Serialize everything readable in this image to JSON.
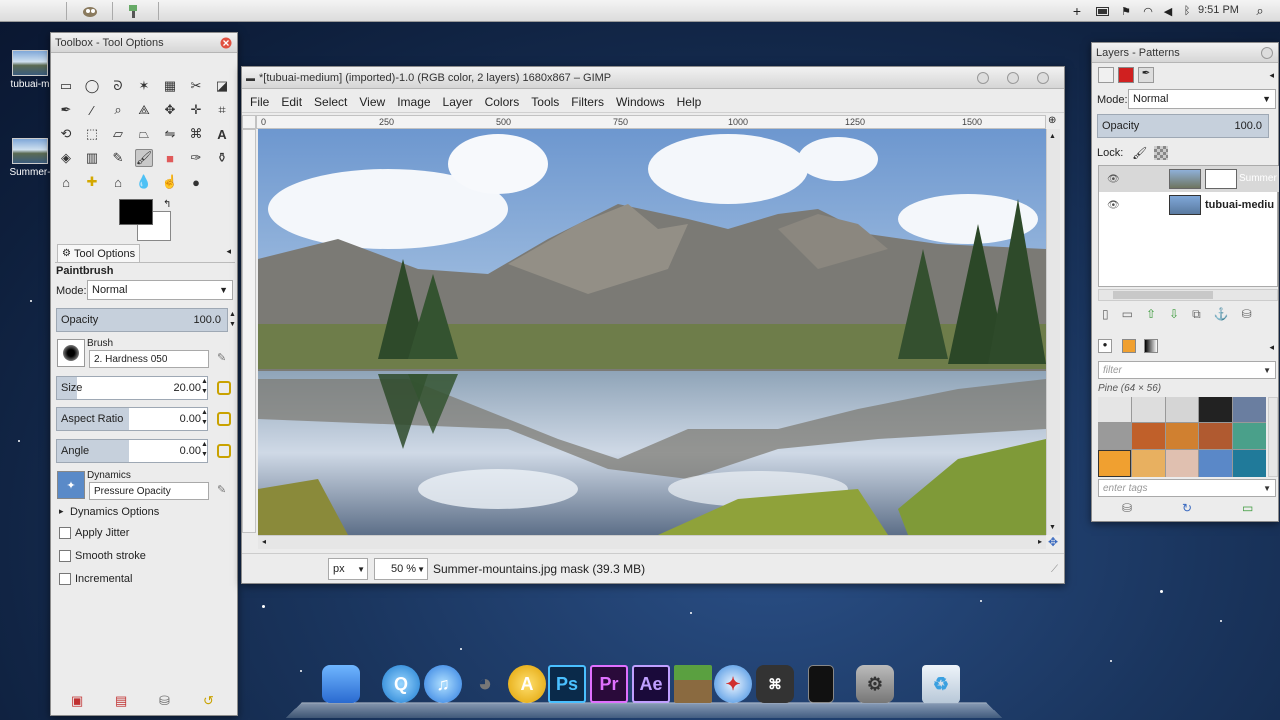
{
  "menubar": {
    "clock": "9:51 PM"
  },
  "desktop": {
    "icons": [
      {
        "label": "tubuai-m"
      },
      {
        "label": "Summer-"
      }
    ]
  },
  "toolbox": {
    "title": "Toolbox - Tool Options",
    "tool_options_tab": "Tool Options",
    "tool_name": "Paintbrush",
    "mode_label": "Mode:",
    "mode_value": "Normal",
    "opacity_label": "Opacity",
    "opacity_value": "100.0",
    "brush_label": "Brush",
    "brush_value": "2. Hardness 050",
    "size_label": "Size",
    "size_value": "20.00",
    "aspect_label": "Aspect Ratio",
    "aspect_value": "0.00",
    "angle_label": "Angle",
    "angle_value": "0.00",
    "dynamics_label": "Dynamics",
    "dynamics_value": "Pressure Opacity",
    "dynamics_options": "Dynamics Options",
    "apply_jitter": "Apply Jitter",
    "smooth_stroke": "Smooth stroke",
    "incremental": "Incremental"
  },
  "image_window": {
    "title": "*[tubuai-medium] (imported)-1.0 (RGB color, 2 layers) 1680x867 – GIMP",
    "menus": [
      "File",
      "Edit",
      "Select",
      "View",
      "Image",
      "Layer",
      "Colors",
      "Tools",
      "Filters",
      "Windows",
      "Help"
    ],
    "ruler_marks": [
      "0",
      "250",
      "500",
      "750",
      "1000",
      "1250",
      "1500"
    ],
    "unit": "px",
    "zoom": "50 %",
    "status": "Summer-mountains.jpg mask (39.3 MB)"
  },
  "layers": {
    "title": "Layers - Patterns",
    "mode_label": "Mode:",
    "mode_value": "Normal",
    "opacity_label": "Opacity",
    "opacity_value": "100.0",
    "lock_label": "Lock:",
    "items": [
      {
        "name": "Summer"
      },
      {
        "name": "tubuai-mediu"
      }
    ],
    "filter_placeholder": "filter",
    "pattern_name": "Pine (64 × 56)",
    "tags_placeholder": "enter tags"
  },
  "dock": {
    "apps": [
      {
        "name": "Finder",
        "glyph": ""
      },
      {
        "name": "QuickTime",
        "glyph": "Q"
      },
      {
        "name": "iTunes",
        "glyph": "♫"
      },
      {
        "name": "GIMP",
        "glyph": "◕"
      },
      {
        "name": "Anything",
        "glyph": "A"
      },
      {
        "name": "Photoshop",
        "glyph": "Ps"
      },
      {
        "name": "Premiere",
        "glyph": "Pr"
      },
      {
        "name": "After Effects",
        "glyph": "Ae"
      },
      {
        "name": "Minecraft",
        "glyph": ""
      },
      {
        "name": "Safari",
        "glyph": "✦"
      },
      {
        "name": "Keyboard Viewer",
        "glyph": "⌘"
      },
      {
        "name": "iPhone",
        "glyph": ""
      },
      {
        "name": "System Preferences",
        "glyph": "⚙"
      },
      {
        "name": "Trash",
        "glyph": "♻"
      }
    ]
  }
}
